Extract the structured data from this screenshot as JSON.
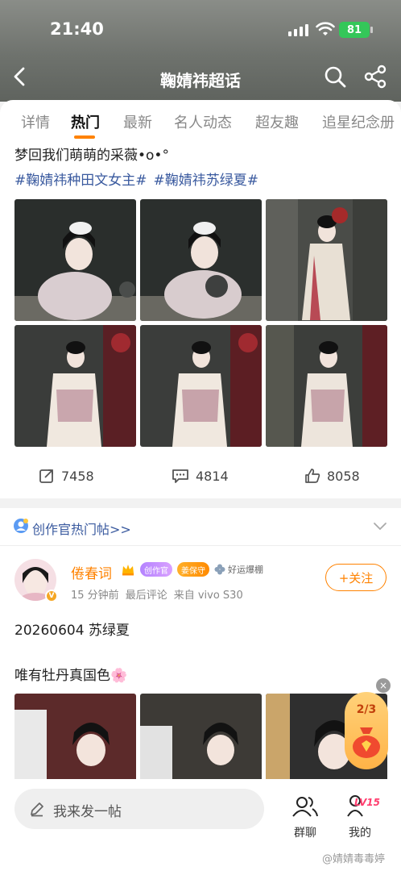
{
  "status_bar": {
    "time": "21:40",
    "battery": "81"
  },
  "nav": {
    "title": "鞠婧祎超话",
    "back_icon": "back-arrow-icon",
    "search_icon": "search-icon",
    "share_icon": "share-icon"
  },
  "tabs": [
    {
      "label": "详情",
      "active": false
    },
    {
      "label": "热门",
      "active": true
    },
    {
      "label": "最新",
      "active": false
    },
    {
      "label": "名人动态",
      "active": false
    },
    {
      "label": "超友趣",
      "active": false
    },
    {
      "label": "追星纪念册",
      "active": false
    }
  ],
  "post1": {
    "text": "梦回我们萌萌的采薇•o•°",
    "tags": [
      "#鞠婧祎种田文女主#",
      "#鞠婧祎苏绿夏#"
    ],
    "repost_count": "7458",
    "comment_count": "4814",
    "like_count": "8058"
  },
  "creator_section": {
    "label": "创作官热门帖>>"
  },
  "post2": {
    "username": "倦春词",
    "badge_creator": "创作官",
    "badge_guard": "姜保守",
    "badge_luck": "好运爆棚",
    "meta_time": "15 分钟前",
    "meta_action": "最后评论",
    "meta_source": "来自 vivo S30",
    "follow_label": "+关注",
    "line1": "20260604 苏绿夏",
    "line2": "唯有牡丹真国色🌸"
  },
  "gift": {
    "count": "2/3",
    "close": "×"
  },
  "bottom_bar": {
    "compose_placeholder": "我来发一帖",
    "group_chat": "群聊",
    "mine": "我的",
    "level": "LV15"
  },
  "watermark": "@婧婧毒毒婷",
  "colors": {
    "accent": "#ff8200",
    "link": "#3a5a9f",
    "battery": "#34c759"
  }
}
